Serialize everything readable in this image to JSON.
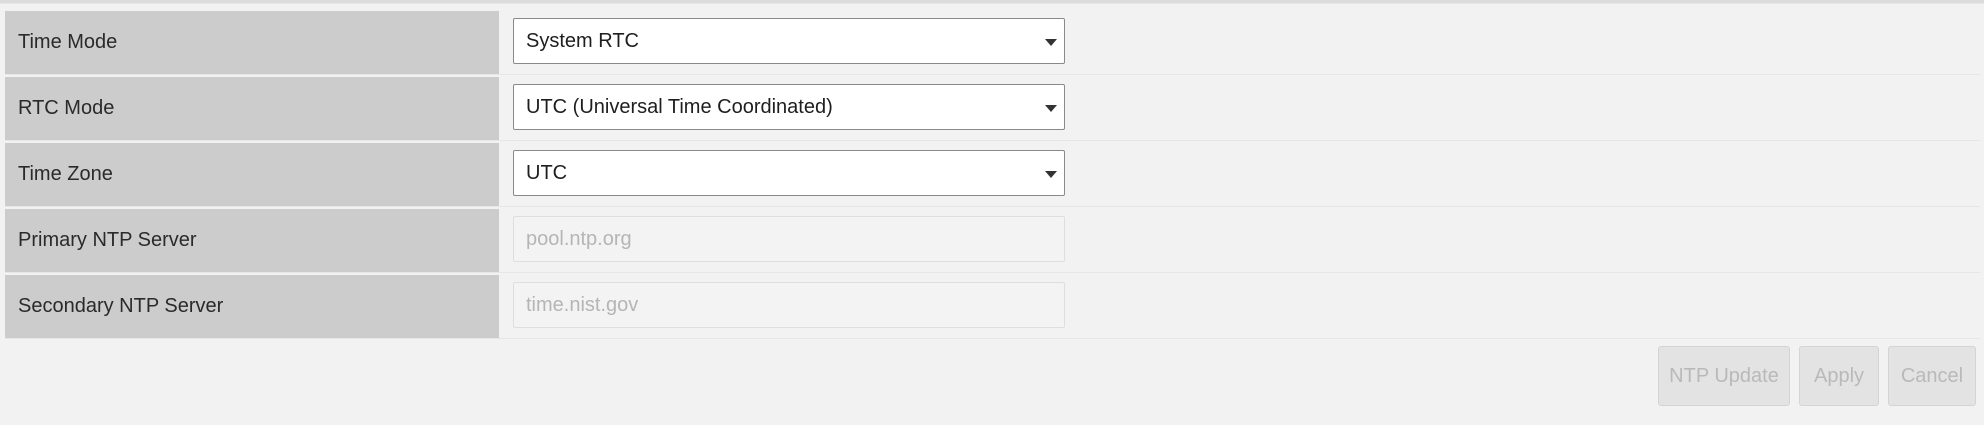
{
  "form": {
    "rows": [
      {
        "label": "Time Mode",
        "type": "select",
        "value": "System RTC"
      },
      {
        "label": "RTC Mode",
        "type": "select",
        "value": "UTC (Universal Time Coordinated)"
      },
      {
        "label": "Time Zone",
        "type": "select",
        "value": "UTC"
      },
      {
        "label": "Primary NTP Server",
        "type": "input",
        "value": "pool.ntp.org"
      },
      {
        "label": "Secondary NTP Server",
        "type": "input",
        "value": "time.nist.gov"
      }
    ]
  },
  "actions": {
    "ntp_update": "NTP Update",
    "apply": "Apply",
    "cancel": "Cancel"
  },
  "icons": {
    "dropdown": "chevron-down-icon"
  },
  "colors": {
    "label_bg": "#cccccc",
    "page_bg": "#f2f2f2",
    "disabled_text": "#b5b5b5"
  }
}
